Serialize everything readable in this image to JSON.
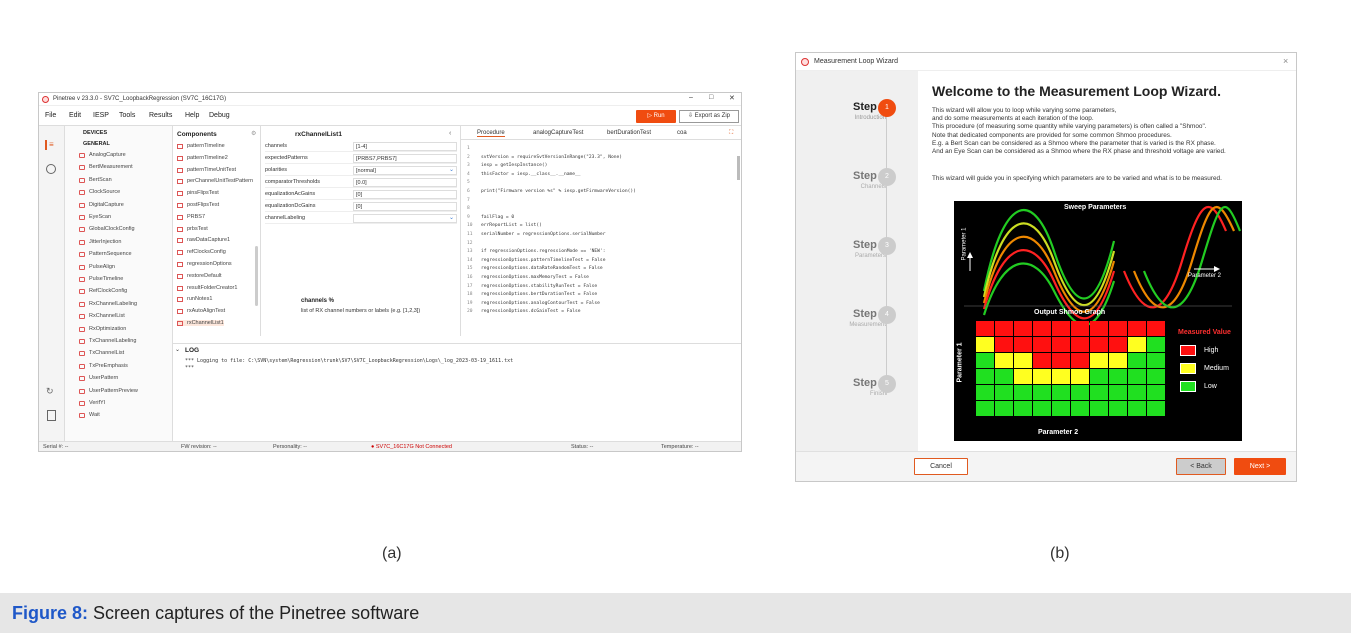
{
  "caption": {
    "label": "Figure 8:",
    "text": "Screen captures of the Pinetree software"
  },
  "sublabels": {
    "a": "(a)",
    "b": "(b)"
  },
  "appA": {
    "title": "Pinetree v 23.3.0 - SV7C_LoopbackRegression (SV7C_16C17G)",
    "menu": [
      "File",
      "Edit",
      "IESP",
      "Tools",
      "Results",
      "Help",
      "Debug"
    ],
    "run": "▷ Run",
    "export": "⇩ Export as Zip",
    "tree": {
      "devices": "DEVICES",
      "general": "GENERAL",
      "items": [
        "AnalogCapture",
        "BertMeasurement",
        "BertScan",
        "ClockSource",
        "DigitalCapture",
        "EyeScan",
        "GlobalClockConfig",
        "JitterInjection",
        "PatternSequence",
        "PulseAlign",
        "PulseTimeline",
        "RefClockConfig",
        "RxChannelLabeling",
        "RxChannelList",
        "RxOptimization",
        "TxChannelLabeling",
        "TxChannelList",
        "TxPreEmphasis",
        "UserPattern",
        "UserPatternPreview",
        "VerifYI",
        "Wait"
      ]
    },
    "components": {
      "header": "Components",
      "items": [
        "patternTimeline",
        "patternTimeline2",
        "patternTimeUnitTest",
        "perChannelUnitTestPattern",
        "pinsFlipsTest",
        "postFlipsTest",
        "PRBS7",
        "prbsTest",
        "rawDataCapture1",
        "refClocksConfig",
        "regressionOptions",
        "restoreDefault",
        "resultFolderCreator1",
        "runNotes1",
        "rxAutoAlignTest",
        "rxChannelList1"
      ]
    },
    "props": {
      "header": "rxChannelList1",
      "rows": [
        {
          "k": "channels",
          "v": "[1-4]"
        },
        {
          "k": "expectedPatterns",
          "v": "[PRBS7,PRBS7]"
        },
        {
          "k": "polarities",
          "v": "[normal]"
        },
        {
          "k": "comparatorThresholds",
          "v": "[0.0]"
        },
        {
          "k": "equalizationAcGains",
          "v": "[0]"
        },
        {
          "k": "equalizationDcGains",
          "v": "[0]"
        },
        {
          "k": "channelLabeling",
          "v": ""
        }
      ],
      "help_title": "channels %",
      "help_text": "list of RX channel numbers or labels (e.g. [1,2,3])"
    },
    "code": {
      "tabs": [
        "Procedure",
        "analogCaptureTest",
        "bertDurationTest",
        "coa"
      ],
      "lines": [
        "",
        "svtVersion = requireSvtVersionInRange(\"23.3\", None)",
        "iesp = getIespInstance()",
        "thisFactor = iesp.__class__.__name__",
        "",
        "print(\"Firmware version %s\" % iesp.getFirmwareVersion())",
        "",
        "",
        "failFlag = 0",
        "errReportList = list()",
        "serialNumber = regressionOptions.serialNumber",
        "",
        "if regressionOptions.regressionMode == 'NEW':",
        "    regressionOptions.patternTimelineTest = False",
        "    regressionOptions.dataRateRandomTest = False",
        "    regressionOptions.maxMemoryTest = False",
        "    regressionOptions.stabilityRunTest = False",
        "    regressionOptions.bertDurationTest = False",
        "    regressionOptions.analogContourTest = False",
        "    regressionOptions.dcGainTest = False"
      ]
    },
    "log": {
      "header": "LOG",
      "line1": "*** Logging to file: C:\\SVN\\system\\Regression\\trunk\\SV7\\SV7C_LoopbackRegression\\Logs\\_log_2023-03-19_1611.txt",
      "line2": "***"
    },
    "status": {
      "serial": "Serial #: --",
      "fw": "FW revision: --",
      "personality": "Personality: --",
      "connection": "● SV7C_16C17G Not Connected",
      "stat": "Status: --",
      "temp": "Temperature: --"
    }
  },
  "appB": {
    "title": "Measurement Loop Wizard",
    "heading": "Welcome to the Measurement Loop Wizard.",
    "paragraph": [
      "This wizard will allow you to loop while varying some parameters,",
      "and do some measurements at each iteration of the loop.",
      "This procedure (of measuring some quantity while varying parameters) is often called a \"Shmoo\".",
      "Note that dedicated components are provided for some common Shmoo procedures.",
      "E.g. a Bert Scan can be considered as a Shmoo where the parameter that is varied is the RX phase.",
      "And an Eye Scan can be considered as a Shmoo where the RX phase and threshold voltage are varied."
    ],
    "guide": "This wizard will guide you in specifying which parameters are to be varied and what is to be measured.",
    "steps": [
      {
        "name": "Step 1",
        "sub": "Introduction",
        "num": "1"
      },
      {
        "name": "Step 2",
        "sub": "Channels",
        "num": "2"
      },
      {
        "name": "Step 3",
        "sub": "Parameters",
        "num": "3"
      },
      {
        "name": "Step 4",
        "sub": "Measurement",
        "num": "4"
      },
      {
        "name": "Step 5",
        "sub": "Finish",
        "num": "5"
      }
    ],
    "diagram": {
      "sweep_title": "Sweep Parameters",
      "param1": "Parameter 1",
      "param2": "Parameter 2",
      "shmoo_title": "Output Shmoo Graph",
      "legend_title": "Measured Value",
      "legend": [
        "High",
        "Medium",
        "Low"
      ]
    },
    "buttons": {
      "cancel": "Cancel",
      "back": "< Back",
      "next": "Next >"
    }
  }
}
